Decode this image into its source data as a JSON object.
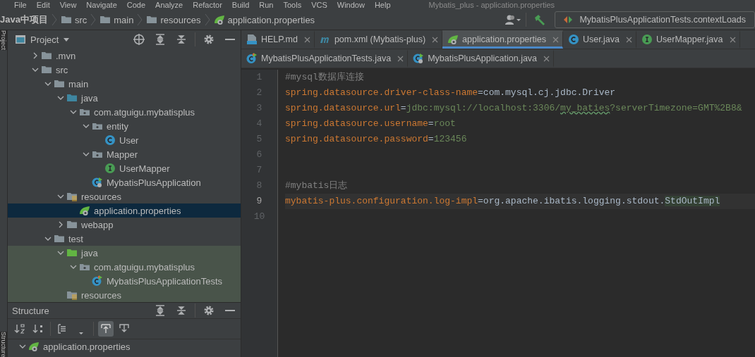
{
  "menu_bar": {
    "items": [
      "File",
      "Edit",
      "View",
      "Navigate",
      "Code",
      "Analyze",
      "Refactor",
      "Build",
      "Run",
      "Tools",
      "VCS",
      "Window",
      "Help"
    ],
    "title": "Mybatis_plus - application.properties"
  },
  "breadcrumbs": [
    {
      "label": "Java中项目",
      "kind": "project"
    },
    {
      "label": "src",
      "kind": "folder"
    },
    {
      "label": "main",
      "kind": "folder"
    },
    {
      "label": "resources",
      "kind": "folder"
    },
    {
      "label": "application.properties",
      "kind": "properties"
    }
  ],
  "run_config": {
    "label": "MybatisPlusApplicationTests.contextLoads"
  },
  "side_stripe": {
    "top": "Project",
    "bottom": "Structure"
  },
  "project_panel": {
    "title": "Project",
    "tree": [
      {
        "label": ".mvn",
        "kind": "folder",
        "expanded": false,
        "selected": false,
        "test_scope": false
      },
      {
        "label": "src",
        "kind": "folder",
        "expanded": true,
        "selected": false,
        "test_scope": false,
        "children": [
          {
            "label": "main",
            "kind": "folder",
            "expanded": true,
            "selected": false,
            "test_scope": false,
            "children": [
              {
                "label": "java",
                "kind": "source",
                "expanded": true,
                "selected": false,
                "test_scope": false,
                "children": [
                  {
                    "label": "com.atguigu.mybatisplus",
                    "kind": "package",
                    "expanded": true,
                    "selected": false,
                    "test_scope": false,
                    "children": [
                      {
                        "label": "entity",
                        "kind": "package",
                        "expanded": true,
                        "selected": false,
                        "test_scope": false,
                        "children": [
                          {
                            "label": "User",
                            "kind": "class",
                            "selected": false,
                            "test_scope": false
                          }
                        ]
                      },
                      {
                        "label": "Mapper",
                        "kind": "package",
                        "expanded": true,
                        "selected": false,
                        "test_scope": false,
                        "children": [
                          {
                            "label": "UserMapper",
                            "kind": "interface",
                            "selected": false,
                            "test_scope": false
                          }
                        ]
                      },
                      {
                        "label": "MybatisPlusApplication",
                        "kind": "spring-class",
                        "selected": false,
                        "test_scope": false
                      }
                    ]
                  }
                ]
              },
              {
                "label": "resources",
                "kind": "resources",
                "expanded": true,
                "selected": false,
                "test_scope": false,
                "children": [
                  {
                    "label": "application.properties",
                    "kind": "properties",
                    "selected": true,
                    "test_scope": false
                  }
                ]
              },
              {
                "label": "webapp",
                "kind": "folder",
                "expanded": false,
                "selected": false,
                "test_scope": false
              }
            ]
          },
          {
            "label": "test",
            "kind": "folder",
            "expanded": true,
            "selected": false,
            "test_scope": false,
            "children": [
              {
                "label": "java",
                "kind": "test-source",
                "expanded": true,
                "selected": false,
                "test_scope": true,
                "children": [
                  {
                    "label": "com.atguigu.mybatisplus",
                    "kind": "package",
                    "expanded": true,
                    "selected": false,
                    "test_scope": true,
                    "children": [
                      {
                        "label": "MybatisPlusApplicationTests",
                        "kind": "test-class",
                        "selected": false,
                        "test_scope": true
                      }
                    ]
                  }
                ]
              },
              {
                "label": "resources",
                "kind": "test-resources",
                "selected": false,
                "test_scope": true
              }
            ]
          }
        ]
      }
    ]
  },
  "structure_panel": {
    "title": "Structure",
    "tree": [
      {
        "label": "application.properties",
        "kind": "properties",
        "expanded": true,
        "selected": false
      }
    ]
  },
  "tab_rows": [
    [
      {
        "label": "HELP.md",
        "kind": "markdown",
        "selected": false
      },
      {
        "label": "pom.xml (Mybatis-plus)",
        "kind": "maven",
        "selected": false
      },
      {
        "label": "application.properties",
        "kind": "properties",
        "selected": true
      },
      {
        "label": "User.java",
        "kind": "class",
        "selected": false
      },
      {
        "label": "UserMapper.java",
        "kind": "interface",
        "selected": false
      }
    ],
    [
      {
        "label": "MybatisPlusApplicationTests.java",
        "kind": "test-class",
        "selected": false
      },
      {
        "label": "MybatisPlusApplication.java",
        "kind": "spring-class",
        "selected": false
      }
    ]
  ],
  "editor": {
    "lines": [
      {
        "number": "1",
        "current": false,
        "tokens": [
          {
            "kind": "comment",
            "text": "#mysql数据库连接"
          }
        ]
      },
      {
        "number": "2",
        "current": false,
        "tokens": [
          {
            "kind": "key",
            "text": "spring.datasource.driver-class-name"
          },
          {
            "kind": "sep",
            "text": "="
          },
          {
            "kind": "plain",
            "text": "com.mysql.cj.jdbc.Driver"
          }
        ]
      },
      {
        "number": "3",
        "current": false,
        "tokens": [
          {
            "kind": "key",
            "text": "spring.datasource.url"
          },
          {
            "kind": "sep",
            "text": "="
          },
          {
            "kind": "string",
            "text": "jdbc:mysql://localhost:3306/"
          },
          {
            "kind": "typo",
            "text": "my_baties"
          },
          {
            "kind": "string",
            "text": "?serverTimezone=GMT%2B8&"
          }
        ]
      },
      {
        "number": "4",
        "current": false,
        "tokens": [
          {
            "kind": "key",
            "text": "spring.datasource.username"
          },
          {
            "kind": "sep",
            "text": "="
          },
          {
            "kind": "string",
            "text": "root"
          }
        ]
      },
      {
        "number": "5",
        "current": false,
        "tokens": [
          {
            "kind": "key",
            "text": "spring.datasource.password"
          },
          {
            "kind": "sep",
            "text": "="
          },
          {
            "kind": "string",
            "text": "123456"
          }
        ]
      },
      {
        "number": "6",
        "current": false
      },
      {
        "number": "7",
        "current": false
      },
      {
        "number": "8",
        "current": false,
        "tokens": [
          {
            "kind": "comment",
            "text": "#mybatis日志"
          }
        ]
      },
      {
        "number": "9",
        "current": true,
        "tokens": [
          {
            "kind": "key",
            "text": "mybatis-plus.configuration.log-impl"
          },
          {
            "kind": "sep",
            "text": "="
          },
          {
            "kind": "plain",
            "text": "org.apache.ibatis.logging.stdout."
          },
          {
            "kind": "match",
            "text": "StdOutImpl"
          }
        ]
      },
      {
        "number": "10",
        "current": false
      }
    ]
  }
}
